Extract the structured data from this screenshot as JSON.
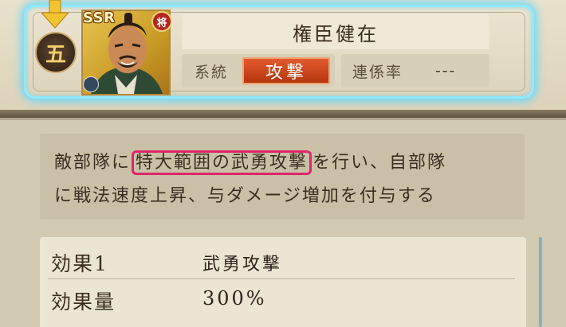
{
  "skill": {
    "rank_icon_text": "五",
    "rarity": "SSR",
    "general_badge": "将",
    "name": "権臣健在",
    "lineage_label": "系統",
    "lineage_value": "攻撃",
    "link_rate_label": "連係率",
    "link_rate_value": "---"
  },
  "description": {
    "line1_before": "敵部隊に",
    "line1_highlight": "特大範囲の武勇攻撃",
    "line1_after": "を行い、自部隊",
    "line2": "に戦法速度上昇、与ダメージ増加を付与する"
  },
  "effects": [
    {
      "label": "効果1",
      "value": "武勇攻撃"
    },
    {
      "label": "効果量",
      "value": "300%"
    }
  ],
  "colors": {
    "glow": "#5fd7ff",
    "lineage_bg": "#c9431a",
    "highlight_border": "#e0256a"
  },
  "icons": [
    "down-arrow-icon",
    "rank-badge-icon",
    "general-badge-icon",
    "unit-type-icon"
  ]
}
